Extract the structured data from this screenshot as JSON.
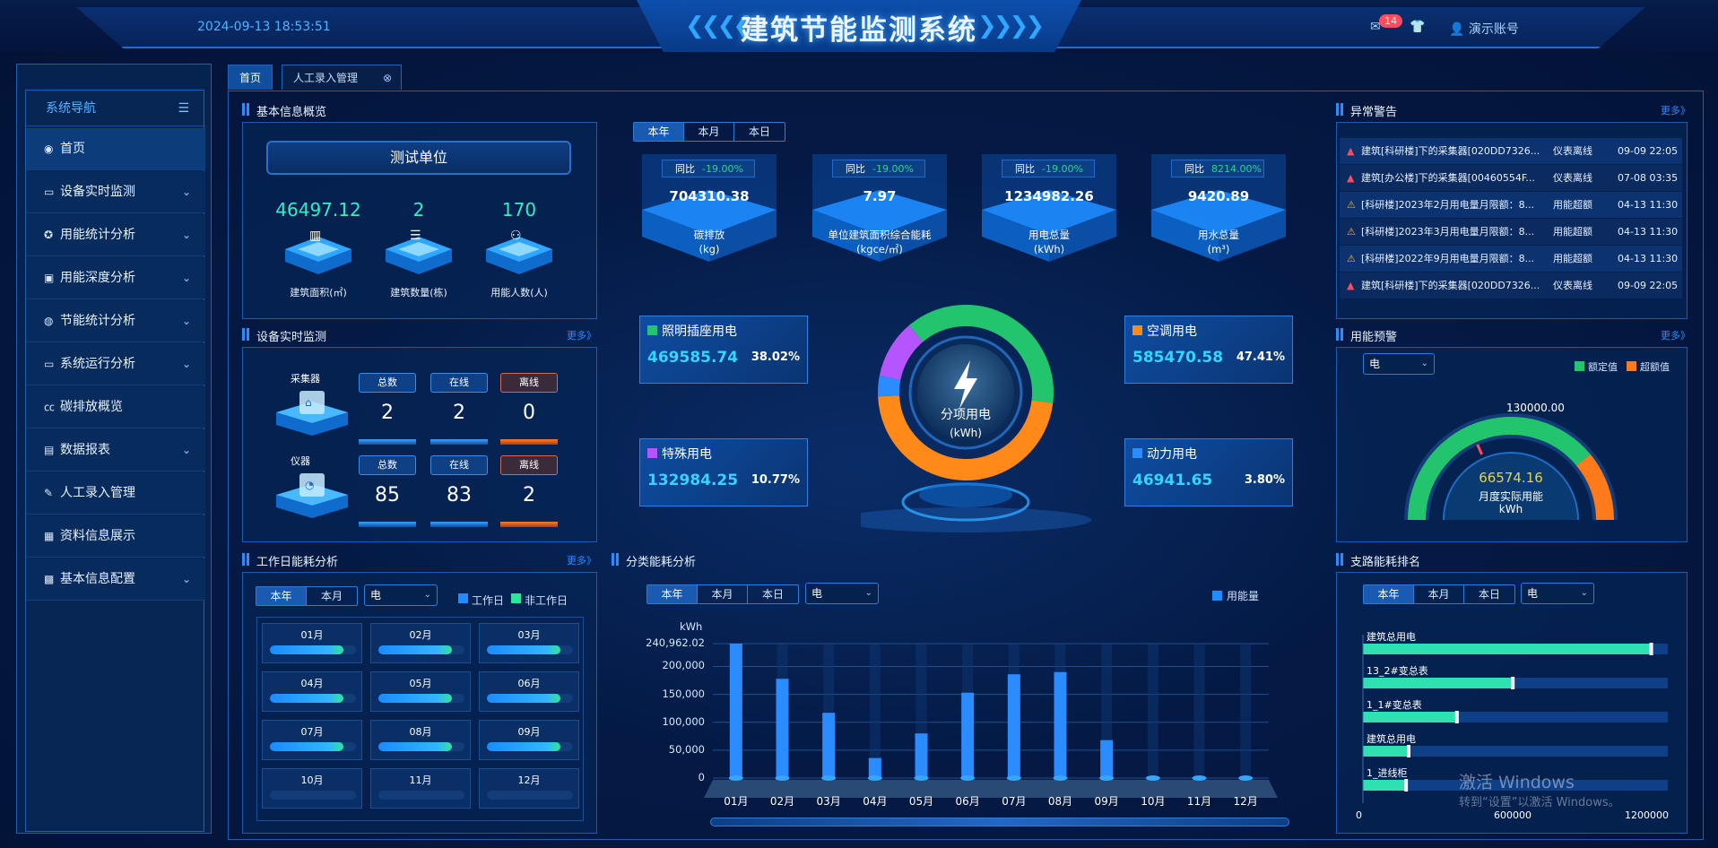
{
  "header": {
    "title": "建筑节能监测系统",
    "datetime": "2024-09-13 18:53:51",
    "notify_count": "14",
    "account": "演示账号"
  },
  "tabs": [
    {
      "label": "首页",
      "active": true
    },
    {
      "label": "人工录入管理",
      "active": false
    }
  ],
  "sidebar": {
    "title": "系统导航",
    "items": [
      {
        "label": "首页",
        "icon": "dashboard-icon",
        "expandable": false
      },
      {
        "label": "设备实时监测",
        "icon": "monitor-icon",
        "expandable": true
      },
      {
        "label": "用能统计分析",
        "icon": "lifebuoy-icon",
        "expandable": true
      },
      {
        "label": "用能深度分析",
        "icon": "image-icon",
        "expandable": true
      },
      {
        "label": "节能统计分析",
        "icon": "globe-icon",
        "expandable": true
      },
      {
        "label": "系统运行分析",
        "icon": "monitor-icon",
        "expandable": true
      },
      {
        "label": "碳排放概览",
        "icon": "co2-icon",
        "expandable": false
      },
      {
        "label": "数据报表",
        "icon": "report-icon",
        "expandable": true
      },
      {
        "label": "人工录入管理",
        "icon": "edit-icon",
        "expandable": false
      },
      {
        "label": "资料信息展示",
        "icon": "folder-icon",
        "expandable": false
      },
      {
        "label": "基本信息配置",
        "icon": "config-icon",
        "expandable": true
      }
    ]
  },
  "basic_info": {
    "title": "基本信息概览",
    "unit_name": "测试单位",
    "kpis": [
      {
        "value": "46497.12",
        "label": "建筑面积(㎡)",
        "icon": "building-icon"
      },
      {
        "value": "2",
        "label": "建筑数量(栋)",
        "icon": "stack-icon"
      },
      {
        "value": "170",
        "label": "用能人数(人)",
        "icon": "people-icon"
      }
    ]
  },
  "period_tabs": [
    "本年",
    "本月",
    "本日"
  ],
  "compare_cards": [
    {
      "badge": "同比",
      "pct": "-19.00%",
      "value": "704310.38",
      "label": "碳排放",
      "unit": "(kg)"
    },
    {
      "badge": "同比",
      "pct": "-19.00%",
      "value": "7.97",
      "label": "单位建筑面积综合能耗",
      "unit": "(kgce/㎡)"
    },
    {
      "badge": "同比",
      "pct": "-19.00%",
      "value": "1234982.26",
      "label": "用电总量",
      "unit": "(kWh)"
    },
    {
      "badge": "同比",
      "pct": "8214.00%",
      "value": "9420.89",
      "label": "用水总量",
      "unit": "(m³)"
    }
  ],
  "sub_power": {
    "center_label": "分项用电",
    "center_unit": "(kWh)",
    "items": [
      {
        "name": "照明插座用电",
        "value": "469585.74",
        "pct": "38.02%",
        "color": "#22c56e"
      },
      {
        "name": "空调用电",
        "value": "585470.58",
        "pct": "47.41%",
        "color": "#ff8a1a"
      },
      {
        "name": "特殊用电",
        "value": "132984.25",
        "pct": "10.77%",
        "color": "#b455ff"
      },
      {
        "name": "动力用电",
        "value": "46941.65",
        "pct": "3.80%",
        "color": "#2a8cff"
      }
    ]
  },
  "device_monitor": {
    "title": "设备实时监测",
    "more": "更多》",
    "headers": [
      "总数",
      "在线",
      "离线"
    ],
    "rows": [
      {
        "name": "采集器",
        "icon": "collector-icon",
        "values": [
          "2",
          "2",
          "0"
        ]
      },
      {
        "name": "仪器",
        "icon": "meter-icon",
        "values": [
          "85",
          "83",
          "2"
        ]
      }
    ]
  },
  "alarms": {
    "title": "异常警告",
    "more": "更多》",
    "rows": [
      {
        "icon": "alarm-red-icon",
        "text": "建筑[科研楼]下的采集器[020DD7326...",
        "type": "仪表离线",
        "time": "09-09 22:05"
      },
      {
        "icon": "alarm-red-icon",
        "text": "建筑[办公楼]下的采集器[00460554F...",
        "type": "仪表离线",
        "time": "07-08 03:35"
      },
      {
        "icon": "warning-icon",
        "text": "[科研楼]2023年2月用电量月限额：8...",
        "type": "用能超额",
        "time": "04-13 11:30"
      },
      {
        "icon": "warning-icon",
        "text": "[科研楼]2023年3月用电量月限额：8...",
        "type": "用能超额",
        "time": "04-13 11:30"
      },
      {
        "icon": "warning-icon",
        "text": "[科研楼]2022年9月用电量月限额：8...",
        "type": "用能超额",
        "time": "04-13 11:30"
      },
      {
        "icon": "alarm-red-icon",
        "text": "建筑[科研楼]下的采集器[020DD7326...",
        "type": "仪表离线",
        "time": "09-09 22:05"
      }
    ]
  },
  "energy_warning": {
    "title": "用能预警",
    "more": "更多》",
    "select": "电",
    "legend": [
      "额定值",
      "超额值"
    ],
    "limit": "130000.00",
    "actual": "66574.16",
    "actual_label": "月度实际用能",
    "unit": "kWh",
    "fraction": 0.51
  },
  "workday": {
    "title": "工作日能耗分析",
    "more": "更多》",
    "tabs": [
      "本年",
      "本月"
    ],
    "select": "电",
    "legend": [
      "工作日",
      "非工作日"
    ],
    "months": [
      {
        "m": "01月",
        "fill": 0.85
      },
      {
        "m": "02月",
        "fill": 0.85
      },
      {
        "m": "03月",
        "fill": 0.85
      },
      {
        "m": "04月",
        "fill": 0.85
      },
      {
        "m": "05月",
        "fill": 0.85
      },
      {
        "m": "06月",
        "fill": 0.85
      },
      {
        "m": "07月",
        "fill": 0.85
      },
      {
        "m": "08月",
        "fill": 0.85
      },
      {
        "m": "09月",
        "fill": 0.85
      },
      {
        "m": "10月",
        "fill": 0
      },
      {
        "m": "11月",
        "fill": 0
      },
      {
        "m": "12月",
        "fill": 0
      }
    ]
  },
  "category": {
    "title": "分类能耗分析",
    "select": "电",
    "legend": "用能量"
  },
  "chart_data": [
    {
      "type": "bar",
      "ylabel": "kWh",
      "series": [
        {
          "name": "用能量",
          "values": [
            240962,
            178000,
            117000,
            36000,
            80000,
            153000,
            186000,
            190000,
            68000,
            0,
            0,
            0
          ]
        }
      ],
      "categories": [
        "01月",
        "02月",
        "03月",
        "04月",
        "05月",
        "06月",
        "07月",
        "08月",
        "09月",
        "10月",
        "11月",
        "12月"
      ],
      "yticks": [
        "240,962.02",
        "200,000",
        "150,000",
        "100,000",
        "50,000",
        "0"
      ],
      "ylim": [
        0,
        240962.02
      ]
    },
    {
      "type": "bar",
      "orientation": "horizontal",
      "categories": [
        "建筑总用电",
        "13_2#变总表",
        "1_1#变总表",
        "建筑总用电",
        "1_进线柜"
      ],
      "values": [
        1135000,
        590000,
        370000,
        180000,
        170000
      ],
      "xticks": [
        "0",
        "600000",
        "1200000"
      ],
      "xlim": [
        0,
        1200000
      ]
    }
  ],
  "ranking": {
    "title": "支路能耗排名",
    "tabs": [
      "本年",
      "本月",
      "本日"
    ],
    "select": "电"
  },
  "watermark": {
    "line1": "激活 Windows",
    "line2": "转到“设置”以激活 Windows。"
  },
  "colors": {
    "accent": "#2a8cff",
    "teal": "#2ff0c8",
    "orange": "#ff7a2a"
  }
}
